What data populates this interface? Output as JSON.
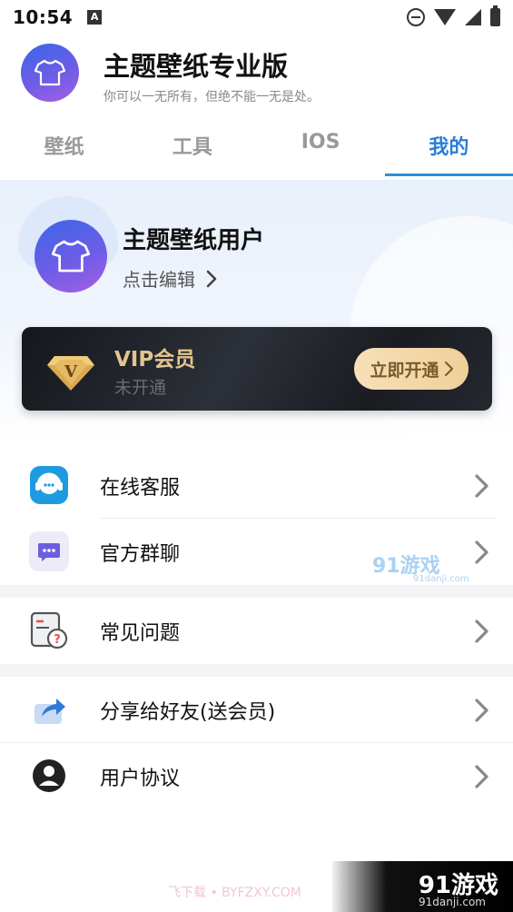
{
  "status_bar": {
    "time": "10:54",
    "notification_badge": "A"
  },
  "app": {
    "title": "主题壁纸专业版",
    "subtitle": "你可以一无所有，但绝不能一无是处。"
  },
  "tabs": [
    {
      "label": "壁纸",
      "active": false
    },
    {
      "label": "工具",
      "active": false
    },
    {
      "label": "IOS",
      "active": false
    },
    {
      "label": "我的",
      "active": true
    }
  ],
  "profile": {
    "name": "主题壁纸用户",
    "edit_label": "点击编辑"
  },
  "vip": {
    "title": "VIP会员",
    "status": "未开通",
    "button_label": "立即开通",
    "gem_letter": "V"
  },
  "menu": {
    "section1": [
      {
        "label": "在线客服",
        "icon": "customer-service-icon"
      },
      {
        "label": "官方群聊",
        "icon": "group-chat-icon"
      }
    ],
    "section2": [
      {
        "label": "常见问题",
        "icon": "faq-icon"
      }
    ],
    "section3": [
      {
        "label": "分享给好友(送会员)",
        "icon": "share-icon"
      },
      {
        "label": "用户协议",
        "icon": "user-agreement-icon"
      }
    ]
  },
  "watermarks": {
    "mid_brand": "91游戏",
    "mid_domain": "91danji.com",
    "bottom_left": "飞下载 • BYFZXY.COM",
    "bottom_right_brand": "91游戏",
    "bottom_right_domain": "91danji.com"
  },
  "colors": {
    "accent": "#2b7dd8",
    "vip_gold": "#e2c58d",
    "vip_bg": "#1f2228"
  }
}
